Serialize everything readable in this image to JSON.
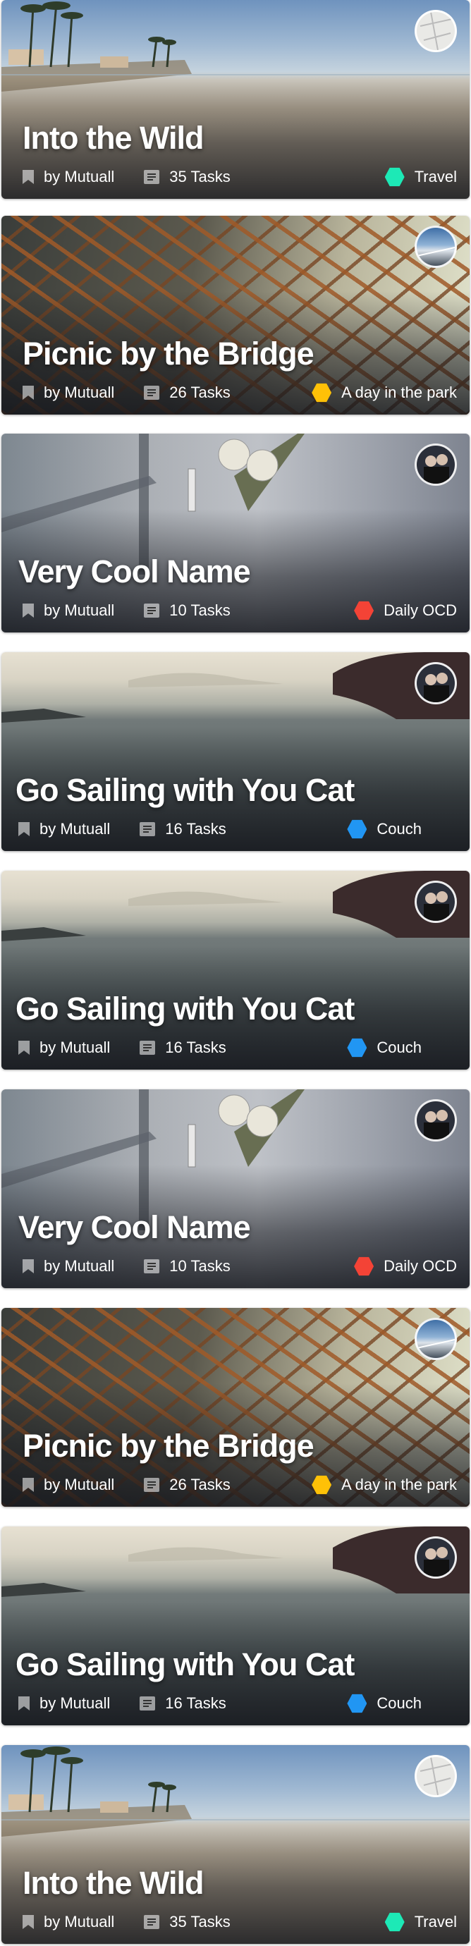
{
  "cards": [
    {
      "title": "Into the Wild",
      "author": "by Mutuall",
      "tasks": "35 Tasks",
      "category": "Travel",
      "category_color": "#1de9b6",
      "image": "beach",
      "avatar": "map"
    },
    {
      "title": "Picnic by the Bridge",
      "author": "by Mutuall",
      "tasks": "26 Tasks",
      "category": "A day in the park",
      "category_color": "#ffc107",
      "image": "bridge",
      "avatar": "road"
    },
    {
      "title": "Very Cool Name",
      "author": "by Mutuall",
      "tasks": "10 Tasks",
      "category": "Daily OCD",
      "category_color": "#f44336",
      "image": "rail",
      "avatar": "people"
    },
    {
      "title": "Go Sailing with You Cat",
      "author": "by Mutuall",
      "tasks": "16 Tasks",
      "category": "Couch",
      "category_color": "#2196f3",
      "image": "sea",
      "avatar": "people"
    },
    {
      "title": "Go Sailing with You Cat",
      "author": "by Mutuall",
      "tasks": "16 Tasks",
      "category": "Couch",
      "category_color": "#2196f3",
      "image": "sea",
      "avatar": "people"
    },
    {
      "title": "Very Cool Name",
      "author": "by Mutuall",
      "tasks": "10 Tasks",
      "category": "Daily OCD",
      "category_color": "#f44336",
      "image": "rail",
      "avatar": "people"
    },
    {
      "title": "Picnic by the Bridge",
      "author": "by Mutuall",
      "tasks": "26 Tasks",
      "category": "A day in the park",
      "category_color": "#ffc107",
      "image": "bridge",
      "avatar": "road"
    },
    {
      "title": "Go Sailing with You Cat",
      "author": "by Mutuall",
      "tasks": "16 Tasks",
      "category": "Couch",
      "category_color": "#2196f3",
      "image": "sea",
      "avatar": "people"
    },
    {
      "title": "Into the Wild",
      "author": "by Mutuall",
      "tasks": "35 Tasks",
      "category": "Travel",
      "category_color": "#1de9b6",
      "image": "beach",
      "avatar": "map"
    }
  ]
}
